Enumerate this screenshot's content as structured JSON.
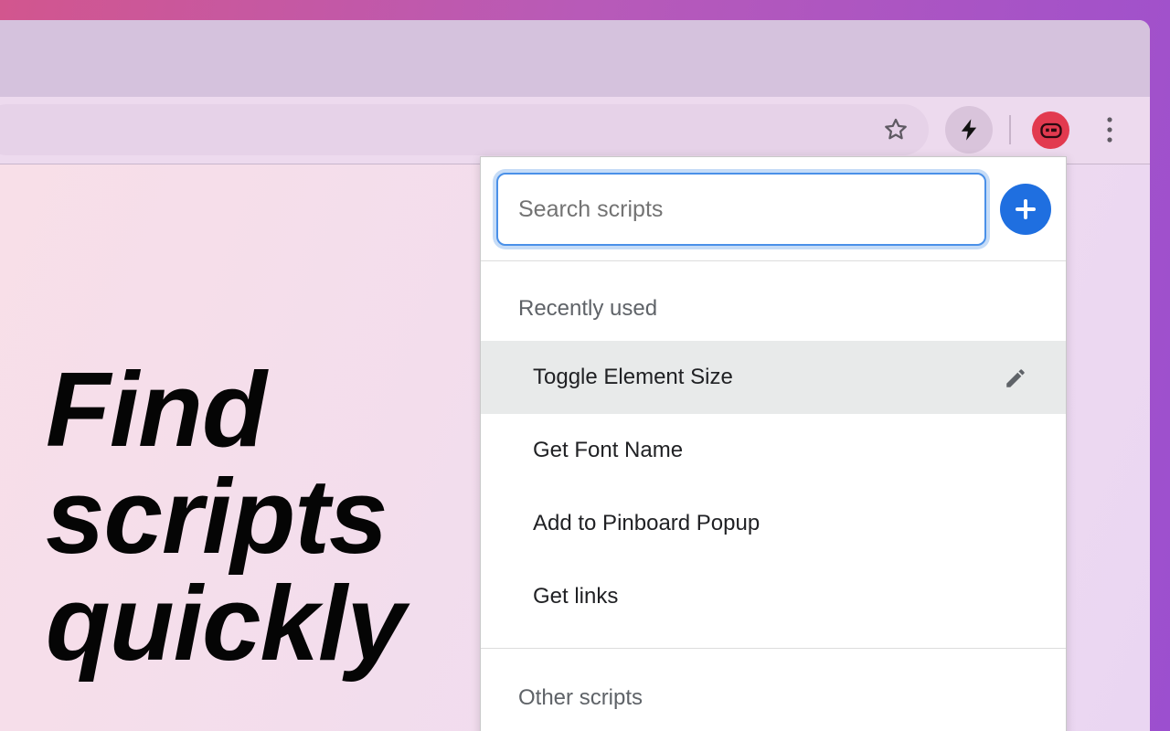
{
  "headline": [
    "Find",
    "scripts",
    "quickly"
  ],
  "toolbar": {
    "bookmark_icon": "star-icon",
    "extension_icon": "lightning-bolt-icon",
    "profile_icon": "avatar-icon",
    "menu_icon": "three-dots-vertical-icon"
  },
  "popup": {
    "search": {
      "placeholder": "Search scripts",
      "value": ""
    },
    "add_button_icon": "plus-icon",
    "recent_label": "Recently used",
    "recent_items": [
      {
        "label": "Toggle Element Size",
        "selected": true
      },
      {
        "label": "Get Font Name",
        "selected": false
      },
      {
        "label": "Add to Pinboard Popup",
        "selected": false
      },
      {
        "label": "Get links",
        "selected": false
      }
    ],
    "other_label": "Other scripts"
  },
  "colors": {
    "accent": "#1f6fe0",
    "focus_ring": "#4a90e8",
    "avatar": "#e23a4f",
    "selected_row": "#e8eaea"
  }
}
